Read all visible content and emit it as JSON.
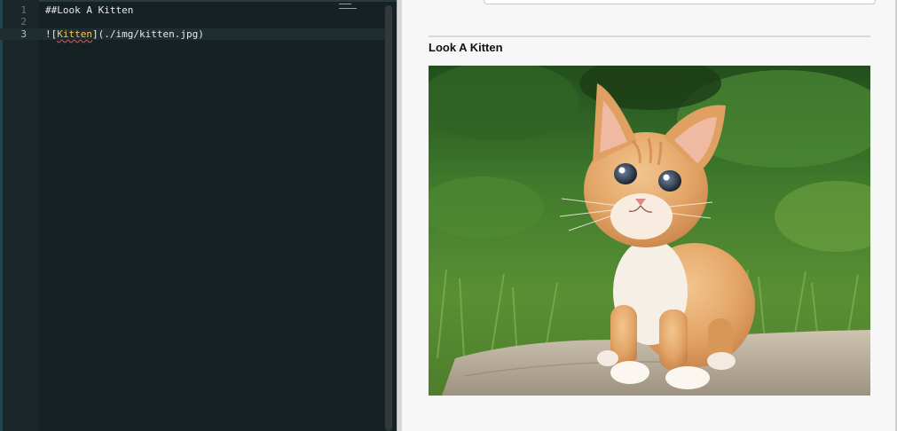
{
  "editor": {
    "lines": [
      {
        "number": "1",
        "text": "##Look A Kitten"
      },
      {
        "number": "2",
        "text": ""
      },
      {
        "number": "3",
        "prefix": "![",
        "link_text": "Kitten",
        "suffix": "](./img/kitten.jpg)"
      }
    ],
    "active_line": 3
  },
  "preview": {
    "heading": "Look A Kitten",
    "image_alt": "Kitten"
  },
  "colors": {
    "editor_background": "#162124",
    "link_token": "#f3c75a",
    "spellcheck_underline": "#e04a4a",
    "preview_background": "#f7f7f7"
  },
  "icons": [
    "kitten-image"
  ]
}
